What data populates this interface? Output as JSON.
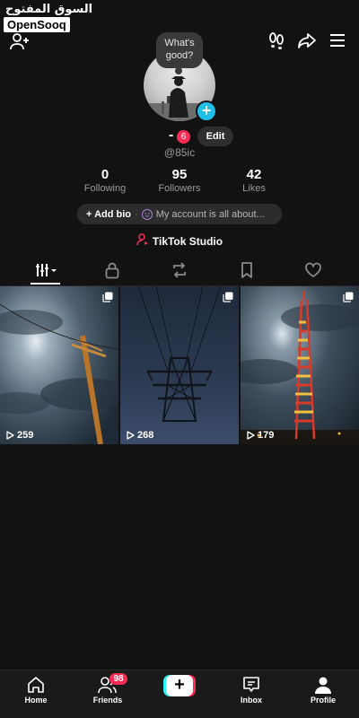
{
  "watermark": {
    "arabic": "السوق المفتوح",
    "english": "OpenSooq"
  },
  "profile": {
    "thought_bubble": "What's good?",
    "display_name": "-",
    "notification_count": "6",
    "edit_label": "Edit",
    "username": "@85ic"
  },
  "stats": [
    {
      "value": "0",
      "label": "Following"
    },
    {
      "value": "95",
      "label": "Followers"
    },
    {
      "value": "42",
      "label": "Likes"
    }
  ],
  "bio": {
    "add_label": "+ Add bio",
    "separator": "·",
    "placeholder": "My account is all about..."
  },
  "studio": {
    "label": "TikTok Studio"
  },
  "tabs": [
    "videos-tab",
    "private-tab",
    "reposts-tab",
    "saved-tab",
    "liked-tab"
  ],
  "videos": [
    {
      "views": "259",
      "subject": "utility pole at night"
    },
    {
      "views": "268",
      "subject": "power transmission tower"
    },
    {
      "views": "179",
      "subject": "red and white telecom tower"
    }
  ],
  "nav": {
    "home": "Home",
    "friends": "Friends",
    "friends_badge": "98",
    "inbox": "Inbox",
    "profile": "Profile"
  },
  "colors": {
    "accent_red": "#fe2c55",
    "accent_cyan": "#25f4ee",
    "avatar_plus": "#20bfe8",
    "background": "#121212"
  }
}
